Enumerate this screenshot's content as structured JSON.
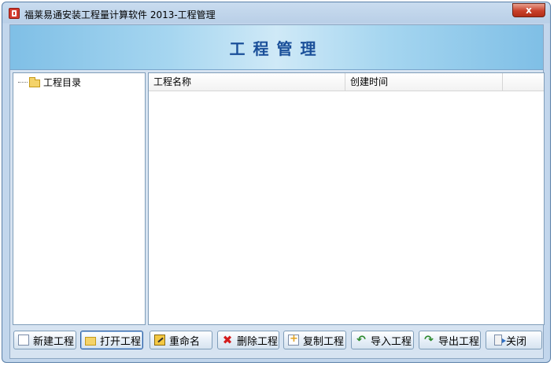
{
  "window": {
    "title": "福莱易通安装工程量计算软件 2013-工程管理",
    "close_label": "x"
  },
  "banner": {
    "title": "工程管理"
  },
  "tree": {
    "root_label": "工程目录"
  },
  "list": {
    "columns": [
      "工程名称",
      "创建时间",
      ""
    ]
  },
  "toolbar": {
    "new_label": "新建工程",
    "open_label": "打开工程",
    "rename_label": "重命名",
    "delete_label": "删除工程",
    "copy_label": "复制工程",
    "import_label": "导入工程",
    "export_label": "导出工程",
    "close_label": "关闭"
  },
  "colors": {
    "banner_title": "#1a4f99",
    "close_button": "#c8402a"
  },
  "icons": [
    "app-icon",
    "close-icon",
    "folder-icon",
    "new-file-icon",
    "open-folder-icon",
    "rename-icon",
    "delete-icon",
    "copy-icon",
    "import-icon",
    "export-icon",
    "exit-icon"
  ]
}
